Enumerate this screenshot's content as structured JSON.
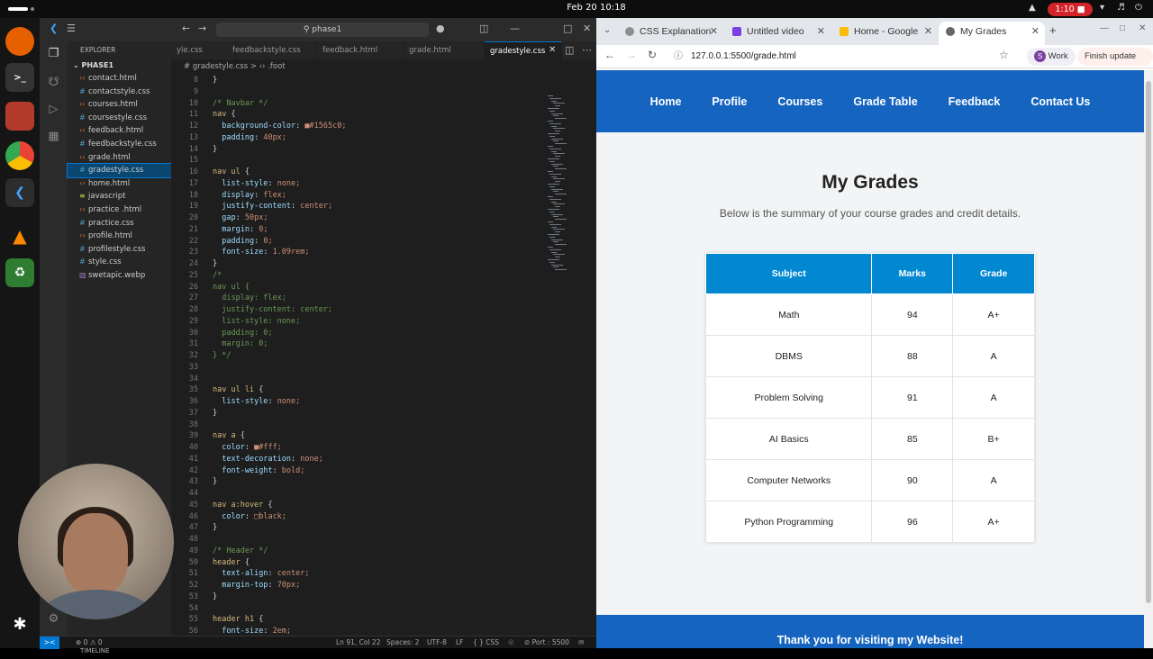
{
  "system": {
    "date_time": "Feb 20  10:18",
    "recording": "1:10"
  },
  "vscode": {
    "command_center": "phase1",
    "explorer_title": "EXPLORER",
    "project": "PHASE1",
    "files": [
      {
        "name": "contact.html",
        "type": "html"
      },
      {
        "name": "contactstyle.css",
        "type": "css"
      },
      {
        "name": "courses.html",
        "type": "html"
      },
      {
        "name": "coursestyle.css",
        "type": "css"
      },
      {
        "name": "feedback.html",
        "type": "html"
      },
      {
        "name": "feedbackstyle.css",
        "type": "css"
      },
      {
        "name": "grade.html",
        "type": "html"
      },
      {
        "name": "gradestyle.css",
        "type": "css"
      },
      {
        "name": "home.html",
        "type": "html"
      },
      {
        "name": "javascript",
        "type": "js"
      },
      {
        "name": "practice .html",
        "type": "html"
      },
      {
        "name": "practice.css",
        "type": "css"
      },
      {
        "name": "profile.html",
        "type": "html"
      },
      {
        "name": "profilestyle.css",
        "type": "css"
      },
      {
        "name": "style.css",
        "type": "css"
      },
      {
        "name": "swetapic.webp",
        "type": "img"
      }
    ],
    "selected_file": "gradestyle.css",
    "timeline": "TIMELINE",
    "tabs": [
      "yle.css",
      "feedbackstyle.css",
      "feedback.html",
      "grade.html",
      "gradestyle.css"
    ],
    "breadcrumb": "# gradestyle.css > ‹› .foot",
    "code_lines": [
      {
        "n": "8",
        "t": "}"
      },
      {
        "n": "9",
        "t": ""
      },
      {
        "n": "10",
        "t": "/* Navbar */"
      },
      {
        "n": "11",
        "t": "nav {"
      },
      {
        "n": "12",
        "t": "  background-color: ■#1565c0;"
      },
      {
        "n": "13",
        "t": "  padding: 40px;"
      },
      {
        "n": "14",
        "t": "}"
      },
      {
        "n": "15",
        "t": ""
      },
      {
        "n": "16",
        "t": "nav ul {"
      },
      {
        "n": "17",
        "t": "  list-style: none;"
      },
      {
        "n": "18",
        "t": "  display: flex;"
      },
      {
        "n": "19",
        "t": "  justify-content: center;"
      },
      {
        "n": "20",
        "t": "  gap: 50px;"
      },
      {
        "n": "21",
        "t": "  margin: 0;"
      },
      {
        "n": "22",
        "t": "  padding: 0;"
      },
      {
        "n": "23",
        "t": "  font-size: 1.09rem;"
      },
      {
        "n": "24",
        "t": "}"
      },
      {
        "n": "25",
        "t": "/*"
      },
      {
        "n": "26",
        "t": "nav ul {"
      },
      {
        "n": "27",
        "t": "  display: flex;"
      },
      {
        "n": "28",
        "t": "  justify-content: center;"
      },
      {
        "n": "29",
        "t": "  list-style: none;"
      },
      {
        "n": "30",
        "t": "  padding: 0;"
      },
      {
        "n": "31",
        "t": "  margin: 0;"
      },
      {
        "n": "32",
        "t": "} */"
      },
      {
        "n": "33",
        "t": ""
      },
      {
        "n": "34",
        "t": ""
      },
      {
        "n": "35",
        "t": "nav ul li {"
      },
      {
        "n": "36",
        "t": "  list-style: none;"
      },
      {
        "n": "37",
        "t": "}"
      },
      {
        "n": "38",
        "t": ""
      },
      {
        "n": "39",
        "t": "nav a {"
      },
      {
        "n": "40",
        "t": "  color: ■#fff;"
      },
      {
        "n": "41",
        "t": "  text-decoration: none;"
      },
      {
        "n": "42",
        "t": "  font-weight: bold;"
      },
      {
        "n": "43",
        "t": "}"
      },
      {
        "n": "44",
        "t": ""
      },
      {
        "n": "45",
        "t": "nav a:hover {"
      },
      {
        "n": "46",
        "t": "  color: □black;"
      },
      {
        "n": "47",
        "t": "}"
      },
      {
        "n": "48",
        "t": ""
      },
      {
        "n": "49",
        "t": "/* Header */"
      },
      {
        "n": "50",
        "t": "header {"
      },
      {
        "n": "51",
        "t": "  text-align: center;"
      },
      {
        "n": "52",
        "t": "  margin-top: 70px;"
      },
      {
        "n": "53",
        "t": "}"
      },
      {
        "n": "54",
        "t": ""
      },
      {
        "n": "55",
        "t": "header h1 {"
      },
      {
        "n": "56",
        "t": "  font-size: 2em;"
      }
    ],
    "status": {
      "errors": "⊗ 0 ⚠ 0",
      "position": "Ln 91, Col 22",
      "spaces": "Spaces: 2",
      "encoding": "UTF-8",
      "eol": "LF",
      "language": "{ } CSS",
      "port": "⊘ Port : 5500"
    }
  },
  "browser": {
    "tabs": [
      {
        "title": "CSS Explanation",
        "color": "#8e8e8e"
      },
      {
        "title": "Untitled video",
        "color": "#7b3fe4"
      },
      {
        "title": "Home - Google",
        "color": "#fbbc04"
      },
      {
        "title": "My Grades",
        "color": "#666666"
      }
    ],
    "url": "127.0.0.1:5500/grade.html",
    "profile": "Work",
    "profile_initial": "S",
    "update_label": "Finish update"
  },
  "website": {
    "nav": [
      "Home",
      "Profile",
      "Courses",
      "Grade Table",
      "Feedback",
      "Contact Us"
    ],
    "title": "My Grades",
    "subtitle": "Below is the summary of your course grades and credit details.",
    "table": {
      "headers": [
        "Subject",
        "Marks",
        "Grade"
      ],
      "rows": [
        [
          "Math",
          "94",
          "A+"
        ],
        [
          "DBMS",
          "88",
          "A"
        ],
        [
          "Problem Solving",
          "91",
          "A"
        ],
        [
          "AI Basics",
          "85",
          "B+"
        ],
        [
          "Computer Networks",
          "90",
          "A"
        ],
        [
          "Python Programming",
          "96",
          "A+"
        ]
      ]
    },
    "footer": "Thank you for visiting my Website!",
    "colors": {
      "nav": "#1565c0",
      "table_header": "#0288d1"
    }
  }
}
